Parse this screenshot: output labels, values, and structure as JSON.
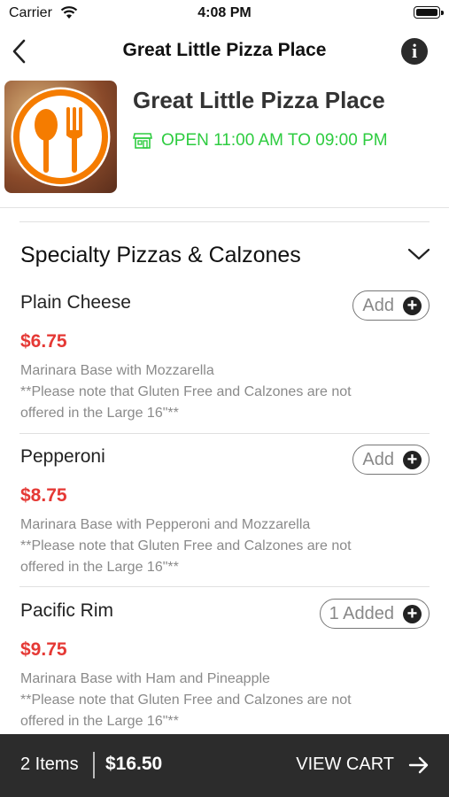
{
  "status_bar": {
    "carrier": "Carrier",
    "time": "4:08 PM"
  },
  "nav": {
    "title": "Great Little Pizza Place"
  },
  "restaurant": {
    "name": "Great Little Pizza Place",
    "hours": "OPEN 11:00 AM TO 09:00 PM",
    "hours_color": "#2ecc40",
    "logo_color": "#f57c00"
  },
  "section": {
    "title": "Specialty Pizzas & Calzones"
  },
  "items": [
    {
      "name": "Plain Cheese",
      "price": "$6.75",
      "desc1": "Marinara Base with Mozzarella",
      "desc2": "**Please note that Gluten Free and Calzones are not",
      "desc3": "offered in the Large 16\"**",
      "add_label": "Add"
    },
    {
      "name": "Pepperoni",
      "price": "$8.75",
      "desc1": "Marinara Base with Pepperoni and Mozzarella",
      "desc2": "**Please note that Gluten Free and Calzones are not",
      "desc3": "offered in the Large 16\"**",
      "add_label": "Add"
    },
    {
      "name": "Pacific Rim",
      "price": "$9.75",
      "desc1": "Marinara Base with Ham and Pineapple",
      "desc2": "**Please note that Gluten Free and Calzones are not",
      "desc3": "offered in the Large 16\"**",
      "add_label": "1 Added"
    }
  ],
  "cart": {
    "count": "2 Items",
    "total": "$16.50",
    "view_label": "VIEW CART"
  },
  "colors": {
    "price": "#e53935",
    "cart_bar": "#2c2c2c"
  }
}
